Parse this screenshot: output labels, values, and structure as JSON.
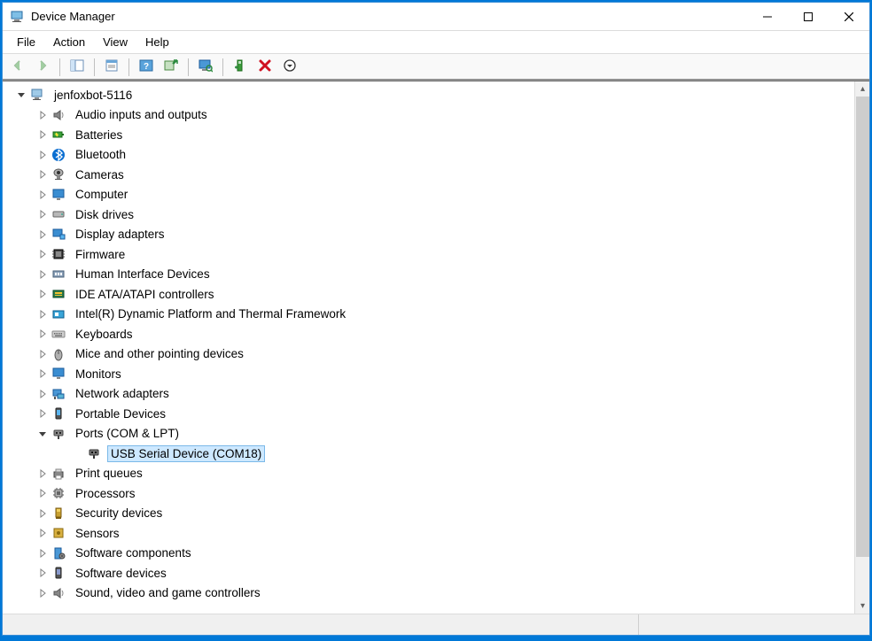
{
  "window": {
    "title": "Device Manager"
  },
  "menubar": {
    "items": [
      "File",
      "Action",
      "View",
      "Help"
    ]
  },
  "toolbar": {
    "buttons": [
      {
        "name": "back-button",
        "icon": "arrow-left",
        "enabled": false
      },
      {
        "name": "forward-button",
        "icon": "arrow-right",
        "enabled": false
      },
      {
        "sep": true
      },
      {
        "name": "show-hide-tree-button",
        "icon": "pane-tree",
        "enabled": true
      },
      {
        "sep": true
      },
      {
        "name": "properties-button",
        "icon": "properties",
        "enabled": true
      },
      {
        "sep": true
      },
      {
        "name": "help-button",
        "icon": "help",
        "enabled": true
      },
      {
        "name": "update-driver-button",
        "icon": "update-driver",
        "enabled": true
      },
      {
        "sep": true
      },
      {
        "name": "scan-hardware-button",
        "icon": "monitor-scan",
        "enabled": true
      },
      {
        "sep": true
      },
      {
        "name": "add-driver-button",
        "icon": "add-driver",
        "enabled": true
      },
      {
        "name": "uninstall-button",
        "icon": "uninstall-x",
        "enabled": true
      },
      {
        "name": "enable-disable-button",
        "icon": "circle-down",
        "enabled": true
      }
    ]
  },
  "tree": {
    "root": {
      "label": "jenfoxbot-5116",
      "expanded": true,
      "icon": "computer-root"
    },
    "nodes": [
      {
        "label": "Audio inputs and outputs",
        "icon": "speaker",
        "expanded": false
      },
      {
        "label": "Batteries",
        "icon": "battery",
        "expanded": false
      },
      {
        "label": "Bluetooth",
        "icon": "bluetooth",
        "expanded": false
      },
      {
        "label": "Cameras",
        "icon": "camera",
        "expanded": false
      },
      {
        "label": "Computer",
        "icon": "monitor",
        "expanded": false
      },
      {
        "label": "Disk drives",
        "icon": "disk",
        "expanded": false
      },
      {
        "label": "Display adapters",
        "icon": "display-adapter",
        "expanded": false
      },
      {
        "label": "Firmware",
        "icon": "firmware",
        "expanded": false
      },
      {
        "label": "Human Interface Devices",
        "icon": "hid",
        "expanded": false
      },
      {
        "label": "IDE ATA/ATAPI controllers",
        "icon": "ide",
        "expanded": false
      },
      {
        "label": "Intel(R) Dynamic Platform and Thermal Framework",
        "icon": "intel-dptf",
        "expanded": false
      },
      {
        "label": "Keyboards",
        "icon": "keyboard",
        "expanded": false
      },
      {
        "label": "Mice and other pointing devices",
        "icon": "mouse",
        "expanded": false
      },
      {
        "label": "Monitors",
        "icon": "monitor",
        "expanded": false
      },
      {
        "label": "Network adapters",
        "icon": "network",
        "expanded": false
      },
      {
        "label": "Portable Devices",
        "icon": "portable",
        "expanded": false
      },
      {
        "label": "Ports (COM & LPT)",
        "icon": "port",
        "expanded": true,
        "children": [
          {
            "label": "USB Serial Device (COM18)",
            "icon": "port-sub",
            "selected": true
          }
        ]
      },
      {
        "label": "Print queues",
        "icon": "printer",
        "expanded": false
      },
      {
        "label": "Processors",
        "icon": "cpu",
        "expanded": false
      },
      {
        "label": "Security devices",
        "icon": "security",
        "expanded": false
      },
      {
        "label": "Sensors",
        "icon": "sensor",
        "expanded": false
      },
      {
        "label": "Software components",
        "icon": "software-comp",
        "expanded": false
      },
      {
        "label": "Software devices",
        "icon": "software-dev",
        "expanded": false
      },
      {
        "label": "Sound, video and game controllers",
        "icon": "sound-video",
        "expanded": false
      }
    ]
  }
}
